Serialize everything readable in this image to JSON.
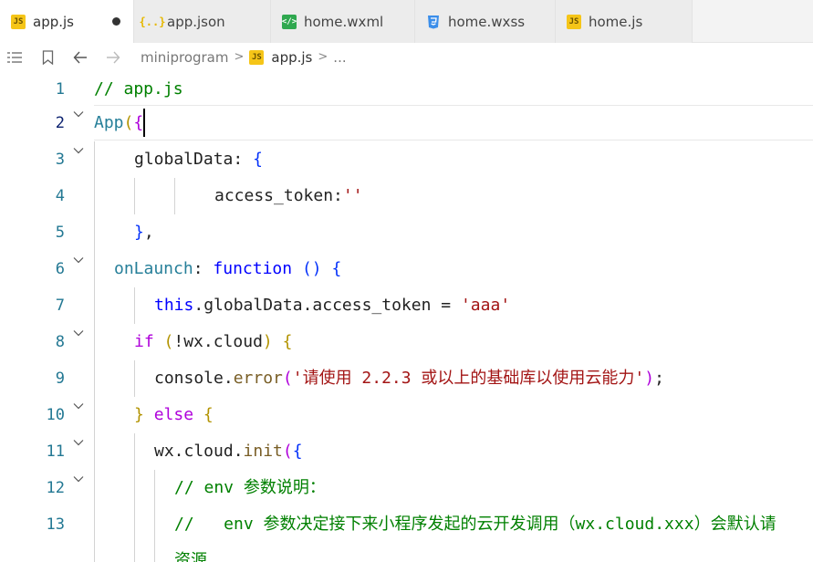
{
  "tabs": [
    {
      "label": "app.js",
      "icon": "js-file-icon",
      "active": true,
      "dirty": true
    },
    {
      "label": "app.json",
      "icon": "json-file-icon"
    },
    {
      "label": "home.wxml",
      "icon": "wxml-file-icon"
    },
    {
      "label": "home.wxss",
      "icon": "css-file-icon"
    },
    {
      "label": "home.js",
      "icon": "js-file-icon"
    }
  ],
  "toolbar": {
    "icons": [
      "list-icon",
      "bookmark-icon",
      "back-arrow-icon",
      "forward-arrow-icon"
    ],
    "breadcrumb": {
      "folder": "miniprogram",
      "file": "app.js",
      "more": "..."
    }
  },
  "editor": {
    "current_line": 2,
    "line_numbers": [
      "1",
      "2",
      "3",
      "4",
      "5",
      "6",
      "7",
      "8",
      "9",
      "10",
      "11",
      "12",
      "13"
    ],
    "lines": [
      {
        "t1": "// app.js"
      },
      {
        "t1": "App",
        "t2": "(",
        "t3": "{"
      },
      {
        "t1": "globalData",
        "t2": ": ",
        "t3": "{"
      },
      {
        "t1": "access_token",
        "t2": ":",
        "t3": "''"
      },
      {
        "t1": "}",
        "t2": ","
      },
      {
        "t1": "onLaunch",
        "t2": ": ",
        "t3": "function",
        "t4": " ",
        "t5": "()",
        "t6": " ",
        "t7": "{"
      },
      {
        "t1": "this",
        "t2": ".globalData.access_token = ",
        "t3": "'aaa'"
      },
      {
        "t1": "if",
        "t2": " ",
        "t3": "(",
        "t4": "!wx.cloud",
        "t5": ")",
        "t6": " ",
        "t7": "{"
      },
      {
        "t1": "console.",
        "t2": "error",
        "t3": "(",
        "t4": "'请使用 2.2.3 或以上的基础库以使用云能力'",
        "t5": ")",
        "t6": ";"
      },
      {
        "t1": "}",
        "t2": " ",
        "t3": "else",
        "t4": " ",
        "t5": "{"
      },
      {
        "t1": "wx.cloud.",
        "t2": "init",
        "t3": "(",
        "t4": "{"
      },
      {
        "t1": "// env 参数说明："
      },
      {
        "t1": "//   env 参数决定接下来小程序发起的云开发调用（wx.cloud.xxx）会默认请"
      },
      {
        "t1": "资源"
      }
    ]
  }
}
